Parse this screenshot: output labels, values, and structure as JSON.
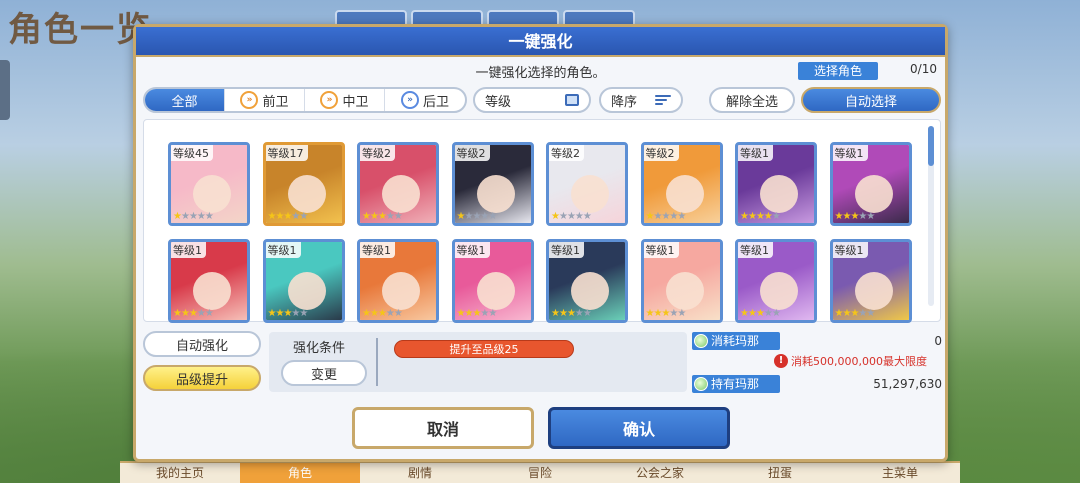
{
  "background": {
    "title": "角色一览",
    "bottom_nav": [
      "我的主页",
      "角色",
      "剧情",
      "冒险",
      "公会之家",
      "扭蛋",
      "主菜单"
    ]
  },
  "dialog": {
    "title": "一键强化",
    "subtitle": "一键强化选择的角色。",
    "select_label": "选择角色",
    "select_count": "0/10",
    "filters": {
      "tabs": [
        {
          "label": "全部",
          "icon": ""
        },
        {
          "label": "前卫",
          "icon": "chevron-icon"
        },
        {
          "label": "中卫",
          "icon": "chevron-icon"
        },
        {
          "label": "后卫",
          "icon": "chevron-icon"
        }
      ],
      "sort_label": "等级",
      "order_label": "降序",
      "clear_label": "解除全选",
      "auto_select_label": "自动选择"
    },
    "characters": [
      {
        "level": "等级45",
        "stars": 1,
        "color1": "#f6b9c8",
        "color2": "#f3d5c8",
        "frame": "blue"
      },
      {
        "level": "等级17",
        "stars": 3,
        "color1": "#c8842a",
        "color2": "#f2c14e",
        "frame": "gold"
      },
      {
        "level": "等级2",
        "stars": 3,
        "color1": "#d8506a",
        "color2": "#f0b0b8",
        "frame": "blue"
      },
      {
        "level": "等级2",
        "stars": 1,
        "color1": "#2a2a3a",
        "color2": "#e8e8f0",
        "frame": "blue"
      },
      {
        "level": "等级2",
        "stars": 1,
        "color1": "#e8e8ee",
        "color2": "#f6d4da",
        "frame": "blue"
      },
      {
        "level": "等级2",
        "stars": 1,
        "color1": "#f09a3a",
        "color2": "#f8d09a",
        "frame": "blue"
      },
      {
        "level": "等级1",
        "stars": 4,
        "color1": "#6a3a9a",
        "color2": "#c89ae0",
        "frame": "blue"
      },
      {
        "level": "等级1",
        "stars": 3,
        "color1": "#b04ab8",
        "color2": "#3a2a4a",
        "frame": "blue"
      },
      {
        "level": "等级1",
        "stars": 3,
        "color1": "#d83a4a",
        "color2": "#f6c0b8",
        "frame": "blue"
      },
      {
        "level": "等级1",
        "stars": 3,
        "color1": "#4ac8c0",
        "color2": "#2a3a4a",
        "frame": "blue"
      },
      {
        "level": "等级1",
        "stars": 3,
        "color1": "#e8783a",
        "color2": "#f8c8a0",
        "frame": "blue"
      },
      {
        "level": "等级1",
        "stars": 3,
        "color1": "#e85a9a",
        "color2": "#f8b8d0",
        "frame": "blue"
      },
      {
        "level": "等级1",
        "stars": 3,
        "color1": "#2a3a5a",
        "color2": "#6ad0b8",
        "frame": "blue"
      },
      {
        "level": "等级1",
        "stars": 3,
        "color1": "#f6a8a0",
        "color2": "#f8e0c8",
        "frame": "blue"
      },
      {
        "level": "等级1",
        "stars": 3,
        "color1": "#9a5ac8",
        "color2": "#e0b8f0",
        "frame": "blue"
      },
      {
        "level": "等级1",
        "stars": 3,
        "color1": "#7a5ab0",
        "color2": "#f0c848",
        "frame": "blue"
      }
    ],
    "auto_enhance_label": "自动强化",
    "rank_up_label": "品级提升",
    "condition": {
      "title": "强化条件",
      "change_label": "变更",
      "tag": "提升至品级25"
    },
    "mana": {
      "cost_label": "消耗玛那",
      "cost_value": "0",
      "warning": "消耗500,000,000最大限度",
      "owned_label": "持有玛那",
      "owned_value": "51,297,630"
    },
    "cancel_label": "取消",
    "confirm_label": "确认"
  }
}
